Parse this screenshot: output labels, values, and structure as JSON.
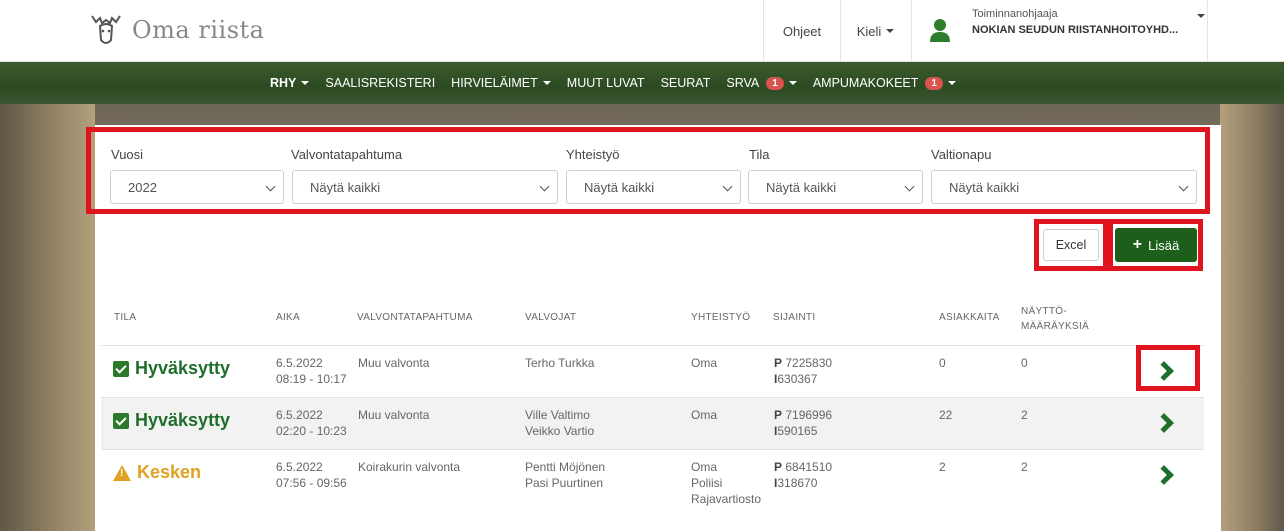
{
  "header": {
    "app_name": "Oma riista",
    "help": "Ohjeet",
    "language": "Kieli",
    "user_role": "Toiminnanohjaaja",
    "user_org": "NOKIAN SEUDUN RIISTANHOITOYHD..."
  },
  "nav": [
    {
      "label": "RHY",
      "dropdown": true,
      "bold": true
    },
    {
      "label": "SAALISREKISTERI"
    },
    {
      "label": "HIRVIELÄIMET",
      "dropdown": true
    },
    {
      "label": "MUUT LUVAT"
    },
    {
      "label": "SEURAT"
    },
    {
      "label": "SRVA",
      "badge": "1",
      "dropdown": true
    },
    {
      "label": "AMPUMAKOKEET",
      "badge": "1",
      "dropdown": true
    }
  ],
  "filters": {
    "year_label": "Vuosi",
    "year_value": "2022",
    "event_label": "Valvontatapahtuma",
    "event_value": "Näytä kaikki",
    "coop_label": "Yhteistyö",
    "coop_value": "Näytä kaikki",
    "state_label": "Tila",
    "state_value": "Näytä kaikki",
    "aid_label": "Valtionapu",
    "aid_value": "Näytä kaikki"
  },
  "actions": {
    "excel": "Excel",
    "add": "Lisää"
  },
  "table": {
    "headers": {
      "status": "TILA",
      "time": "AIKA",
      "event": "VALVONTATAPAHTUMA",
      "supervisors": "VALVOJAT",
      "coop": "YHTEISTYÖ",
      "location": "SIJAINTI",
      "customers": "ASIAKKAITA",
      "orders_1": "NÄYTTÖ-",
      "orders_2": "MÄÄRÄYKSIÄ"
    },
    "rows": [
      {
        "status": "Hyväksytty",
        "date": "6.5.2022",
        "time": "08:19 - 10:17",
        "event": "Muu valvonta",
        "sup1": "Terho Turkka",
        "sup2": "",
        "coop1": "Oma",
        "coop2": "",
        "coop3": "",
        "p": "7225830",
        "i": "630367",
        "customers": "0",
        "orders": "0"
      },
      {
        "status": "Hyväksytty",
        "date": "6.5.2022",
        "time": "02:20 - 10:23",
        "event": "Muu valvonta",
        "sup1": "Ville Valtimo",
        "sup2": "Veikko Vartio",
        "coop1": "Oma",
        "coop2": "",
        "coop3": "",
        "p": "7196996",
        "i": "590165",
        "customers": "22",
        "orders": "2"
      },
      {
        "status": "Kesken",
        "date": "6.5.2022",
        "time": "07:56 - 09:56",
        "event": "Koirakurin valvonta",
        "sup1": "Pentti Möjönen",
        "sup2": "Pasi Puurtinen",
        "coop1": "Oma",
        "coop2": "Poliisi",
        "coop3": "Rajavartiosto",
        "p": "6841510",
        "i": "318670",
        "customers": "2",
        "orders": "2"
      }
    ],
    "p_prefix": "P",
    "i_prefix": "I"
  }
}
